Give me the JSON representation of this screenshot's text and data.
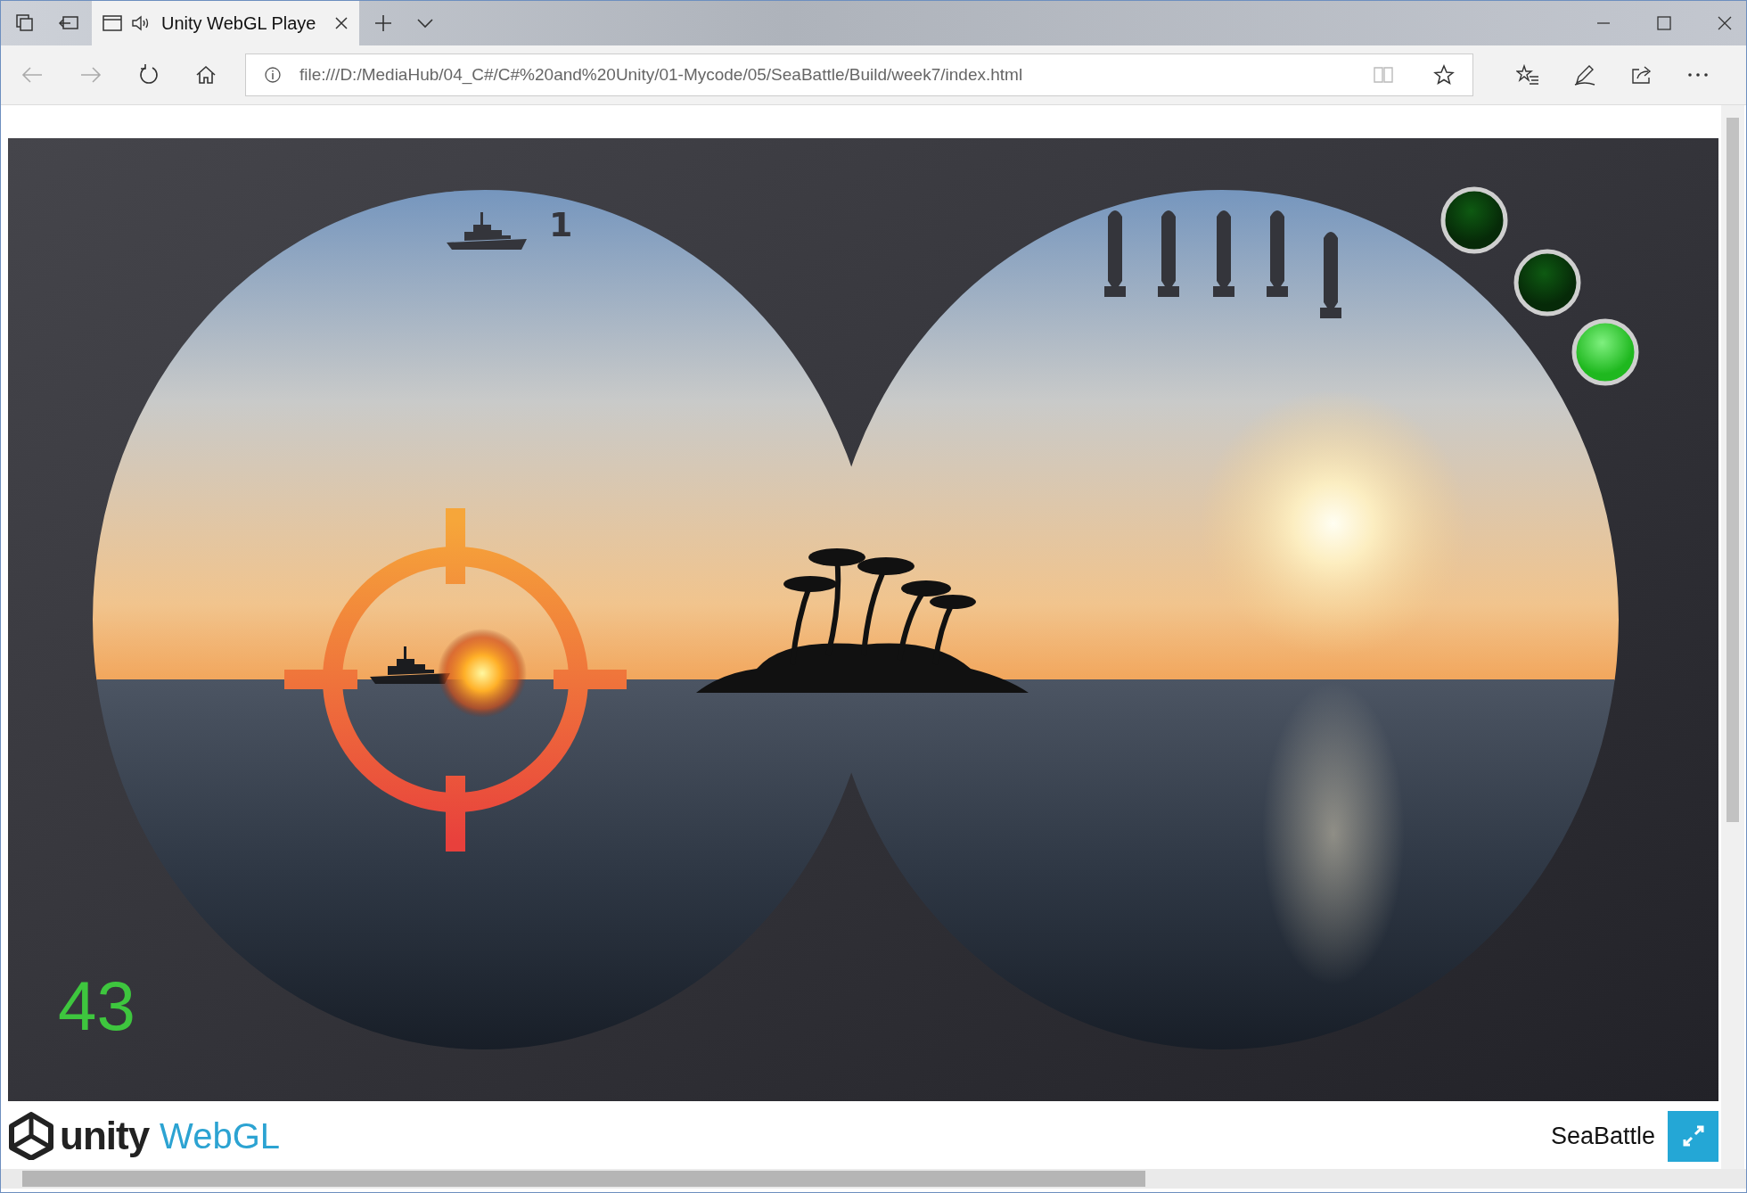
{
  "browser": {
    "tabs": [
      {
        "title": "Unity WebGL Playe",
        "selected": true
      }
    ],
    "address": "file:///D:/MediaHub/04_C#/C#%20and%20Unity/01-Mycode/05/SeaBattle/Build/week7/index.html"
  },
  "game": {
    "ships_sunk": "1",
    "timer": "43",
    "lights": [
      {
        "on": false
      },
      {
        "on": false
      },
      {
        "on": true
      }
    ]
  },
  "footer": {
    "logo_word": "unity",
    "logo_platform": "WebGL",
    "title": "SeaBattle"
  }
}
